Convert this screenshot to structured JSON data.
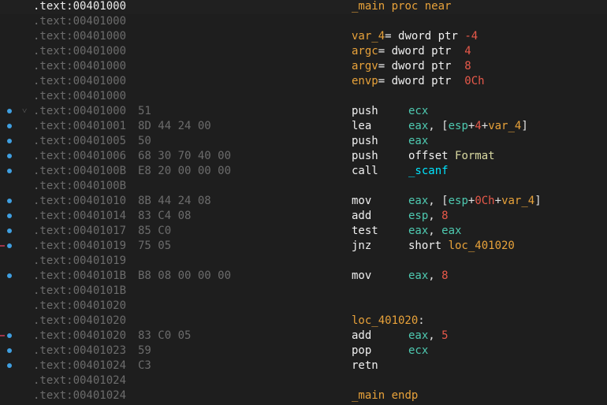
{
  "listing": {
    "rows": [
      {
        "addr": ".text:00401000",
        "bytes": "",
        "code": [
          {
            "t": "_main",
            "c": "kw"
          },
          {
            "t": " proc near",
            "c": "kw"
          }
        ],
        "ops": [],
        "current": true
      },
      {
        "addr": ".text:00401000",
        "bytes": "",
        "code": [],
        "ops": []
      },
      {
        "addr": ".text:00401000",
        "bytes": "",
        "code": [
          {
            "t": "var_4",
            "c": "kw"
          },
          {
            "t": "= dword ptr ",
            "c": "ins"
          },
          {
            "t": "-4",
            "c": "num"
          }
        ],
        "ops": []
      },
      {
        "addr": ".text:00401000",
        "bytes": "",
        "code": [
          {
            "t": "argc",
            "c": "kw"
          },
          {
            "t": "= dword ptr  ",
            "c": "ins"
          },
          {
            "t": "4",
            "c": "num"
          }
        ],
        "ops": []
      },
      {
        "addr": ".text:00401000",
        "bytes": "",
        "code": [
          {
            "t": "argv",
            "c": "kw"
          },
          {
            "t": "= dword ptr  ",
            "c": "ins"
          },
          {
            "t": "8",
            "c": "num"
          }
        ],
        "ops": []
      },
      {
        "addr": ".text:00401000",
        "bytes": "",
        "code": [
          {
            "t": "envp",
            "c": "kw"
          },
          {
            "t": "= dword ptr  ",
            "c": "ins"
          },
          {
            "t": "0Ch",
            "c": "num"
          }
        ],
        "ops": []
      },
      {
        "addr": ".text:00401000",
        "bytes": "",
        "code": [],
        "ops": []
      },
      {
        "addr": ".text:00401000",
        "bytes": "51",
        "code": [
          {
            "t": "push",
            "c": "ins"
          }
        ],
        "ops": [
          {
            "t": "ecx",
            "c": "reg"
          }
        ],
        "dot": true,
        "fold": true
      },
      {
        "addr": ".text:00401001",
        "bytes": "8D 44 24 00",
        "code": [
          {
            "t": "lea",
            "c": "ins"
          }
        ],
        "ops": [
          {
            "t": "eax",
            "c": "reg"
          },
          {
            "t": ", [",
            "c": "pun"
          },
          {
            "t": "esp",
            "c": "reg"
          },
          {
            "t": "+",
            "c": "pun"
          },
          {
            "t": "4",
            "c": "num"
          },
          {
            "t": "+",
            "c": "pun"
          },
          {
            "t": "var_4",
            "c": "kw"
          },
          {
            "t": "]",
            "c": "pun"
          }
        ],
        "dot": true
      },
      {
        "addr": ".text:00401005",
        "bytes": "50",
        "code": [
          {
            "t": "push",
            "c": "ins"
          }
        ],
        "ops": [
          {
            "t": "eax",
            "c": "reg"
          }
        ],
        "dot": true
      },
      {
        "addr": ".text:00401006",
        "bytes": "68 30 70 40 00",
        "code": [
          {
            "t": "push",
            "c": "ins"
          }
        ],
        "ops": [
          {
            "t": "offset ",
            "c": "ins"
          },
          {
            "t": "Format",
            "c": "sym"
          }
        ],
        "dot": true
      },
      {
        "addr": ".text:0040100B",
        "bytes": "E8 20 00 00 00",
        "code": [
          {
            "t": "call",
            "c": "ins"
          }
        ],
        "ops": [
          {
            "t": "_scanf",
            "c": "call"
          }
        ],
        "dot": true
      },
      {
        "addr": ".text:0040100B",
        "bytes": "",
        "code": [],
        "ops": []
      },
      {
        "addr": ".text:00401010",
        "bytes": "8B 44 24 08",
        "code": [
          {
            "t": "mov",
            "c": "ins"
          }
        ],
        "ops": [
          {
            "t": "eax",
            "c": "reg"
          },
          {
            "t": ", [",
            "c": "pun"
          },
          {
            "t": "esp",
            "c": "reg"
          },
          {
            "t": "+",
            "c": "pun"
          },
          {
            "t": "0Ch",
            "c": "num"
          },
          {
            "t": "+",
            "c": "pun"
          },
          {
            "t": "var_4",
            "c": "kw"
          },
          {
            "t": "]",
            "c": "pun"
          }
        ],
        "dot": true
      },
      {
        "addr": ".text:00401014",
        "bytes": "83 C4 08",
        "code": [
          {
            "t": "add",
            "c": "ins"
          }
        ],
        "ops": [
          {
            "t": "esp",
            "c": "reg"
          },
          {
            "t": ", ",
            "c": "pun"
          },
          {
            "t": "8",
            "c": "num"
          }
        ],
        "dot": true
      },
      {
        "addr": ".text:00401017",
        "bytes": "85 C0",
        "code": [
          {
            "t": "test",
            "c": "ins"
          }
        ],
        "ops": [
          {
            "t": "eax",
            "c": "reg"
          },
          {
            "t": ", ",
            "c": "pun"
          },
          {
            "t": "eax",
            "c": "reg"
          }
        ],
        "dot": true
      },
      {
        "addr": ".text:00401019",
        "bytes": "75 05",
        "code": [
          {
            "t": "jnz",
            "c": "ins"
          }
        ],
        "ops": [
          {
            "t": "short ",
            "c": "ins"
          },
          {
            "t": "loc_401020",
            "c": "lbl"
          }
        ],
        "dot": true,
        "marker": true
      },
      {
        "addr": ".text:00401019",
        "bytes": "",
        "code": [],
        "ops": []
      },
      {
        "addr": ".text:0040101B",
        "bytes": "B8 08 00 00 00",
        "code": [
          {
            "t": "mov",
            "c": "ins"
          }
        ],
        "ops": [
          {
            "t": "eax",
            "c": "reg"
          },
          {
            "t": ", ",
            "c": "pun"
          },
          {
            "t": "8",
            "c": "num"
          }
        ],
        "dot": true
      },
      {
        "addr": ".text:0040101B",
        "bytes": "",
        "code": [],
        "ops": []
      },
      {
        "addr": ".text:00401020",
        "bytes": "",
        "code": [],
        "ops": []
      },
      {
        "addr": ".text:00401020",
        "bytes": "",
        "code": [
          {
            "t": "loc_401020",
            "c": "lbl"
          },
          {
            "t": ":",
            "c": "pun"
          }
        ],
        "ops": []
      },
      {
        "addr": ".text:00401020",
        "bytes": "83 C0 05",
        "code": [
          {
            "t": "add",
            "c": "ins"
          }
        ],
        "ops": [
          {
            "t": "eax",
            "c": "reg"
          },
          {
            "t": ", ",
            "c": "pun"
          },
          {
            "t": "5",
            "c": "num"
          }
        ],
        "dot": true,
        "marker": true
      },
      {
        "addr": ".text:00401023",
        "bytes": "59",
        "code": [
          {
            "t": "pop",
            "c": "ins"
          }
        ],
        "ops": [
          {
            "t": "ecx",
            "c": "reg"
          }
        ],
        "dot": true
      },
      {
        "addr": ".text:00401024",
        "bytes": "C3",
        "code": [
          {
            "t": "retn",
            "c": "ins"
          }
        ],
        "ops": [],
        "dot": true
      },
      {
        "addr": ".text:00401024",
        "bytes": "",
        "code": [],
        "ops": []
      },
      {
        "addr": ".text:00401024",
        "bytes": "",
        "code": [
          {
            "t": "_main",
            "c": "kw"
          },
          {
            "t": " endp",
            "c": "kw"
          }
        ],
        "ops": []
      }
    ]
  },
  "colors": {
    "background": "#1e1e1e",
    "address": "#6c6c6c",
    "instruction": "#f0f0f0",
    "keyword": "#e8a23a",
    "register": "#4ec9b0",
    "number": "#e8594a",
    "call_target": "#00e5ff",
    "breakpoint_dot": "#3f9fe0"
  },
  "icons": {
    "fold": "fold-arrow-icon",
    "dot": "execution-dot-icon",
    "marker": "jump-marker-icon"
  }
}
